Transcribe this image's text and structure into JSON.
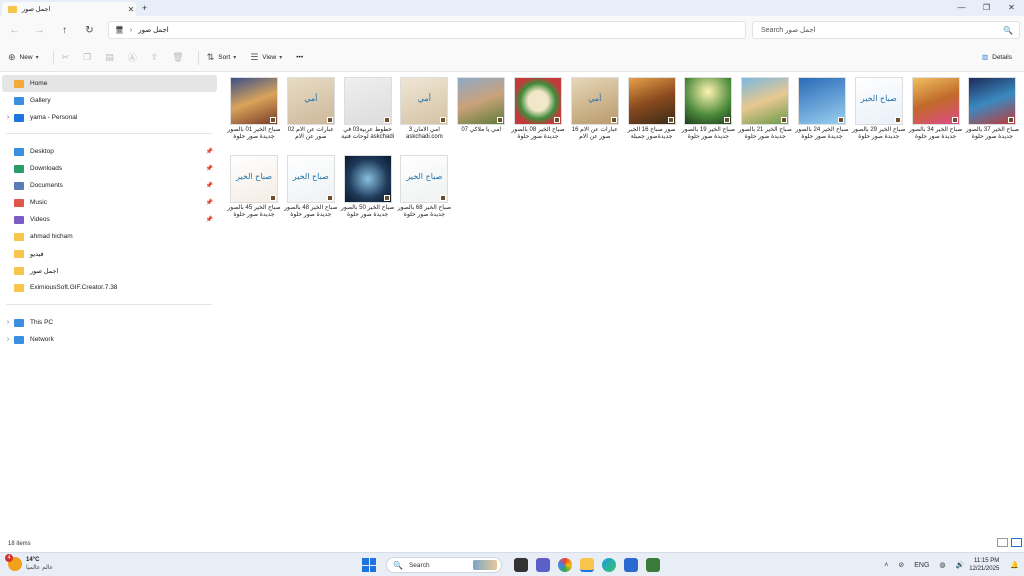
{
  "window": {
    "tab_title": "اجمل صور",
    "tab_close": "✕",
    "new_tab": "+",
    "controls": [
      "—",
      "❐",
      "✕"
    ]
  },
  "nav": {
    "back": "←",
    "forward": "→",
    "up": "↑",
    "refresh": "↻"
  },
  "address": {
    "path": "اجمل صور",
    "chevron": "›",
    "pc_icon": "🖥"
  },
  "search": {
    "placeholder": "Search اجمل صور",
    "icon": "🔍"
  },
  "toolbar": {
    "new_label": "New",
    "sort_label": "Sort",
    "view_label": "View",
    "more_label": "•••",
    "details_label": "Details"
  },
  "sidebar": {
    "items": [
      {
        "label": "Home",
        "icon": "home-icon",
        "color": "#f4a93b",
        "expand": "",
        "selected": true
      },
      {
        "label": "Gallery",
        "icon": "gallery-icon",
        "color": "#3b8fe0",
        "expand": ""
      },
      {
        "label": "yama - Personal",
        "icon": "cloud-icon",
        "color": "#1d73e0",
        "expand": "›"
      },
      {
        "label": "Desktop",
        "icon": "desktop-icon",
        "color": "#3b8fe0",
        "pinned": true
      },
      {
        "label": "Downloads",
        "icon": "download-icon",
        "color": "#2a9d6b",
        "pinned": true
      },
      {
        "label": "Documents",
        "icon": "documents-icon",
        "color": "#5a7bb5",
        "pinned": true
      },
      {
        "label": "Music",
        "icon": "music-icon",
        "color": "#e0564b",
        "pinned": true
      },
      {
        "label": "Videos",
        "icon": "videos-icon",
        "color": "#7b5cc6",
        "pinned": true
      },
      {
        "label": "ahmad hicham",
        "icon": "folder-icon",
        "color": "#f7c44c"
      },
      {
        "label": "فيديو",
        "icon": "folder-icon",
        "color": "#f7c44c"
      },
      {
        "label": "اجمل صور",
        "icon": "folder-icon",
        "color": "#f7c44c"
      },
      {
        "label": "EximiousSoft.GIF.Creator.7.38",
        "icon": "folder-icon",
        "color": "#f7c44c"
      },
      {
        "label": "This PC",
        "icon": "pc-icon",
        "color": "#3b8fe0",
        "expand": "›"
      },
      {
        "label": "Network",
        "icon": "network-icon",
        "color": "#3b8fe0",
        "expand": "›"
      }
    ]
  },
  "files": [
    {
      "name": "صباح الخير 01 بالصور جديدة صور حلوة",
      "bg": "linear-gradient(160deg,#3a4f8a,#d9a45a,#7a3b2a)",
      "thumb_text": ""
    },
    {
      "name": "عبارات عن الام 02 صور عن الام",
      "bg": "linear-gradient(160deg,#e8dcc5,#cdb89a)",
      "thumb_text": "أمي"
    },
    {
      "name": "خطوط عربية03 في لوحات فنية askchadi",
      "bg": "linear-gradient(160deg,#efefef,#dcdcdc)",
      "thumb_text": ""
    },
    {
      "name": "امي الامان 3 askchadi.com",
      "bg": "linear-gradient(160deg,#efe6d5,#d4c3a4)",
      "thumb_text": "أمي"
    },
    {
      "name": "امي يا ملاكي 07",
      "bg": "linear-gradient(160deg,#8fa9c9,#c9a27a,#5e7b3b)",
      "thumb_text": ""
    },
    {
      "name": "صباح الخير 08 بالصور جديدة صور حلوة",
      "bg": "radial-gradient(circle,#f2e8c9 30%,#3f8a3a 55%,#c23a3a 75%)",
      "thumb_text": ""
    },
    {
      "name": "عبارات عن الام 16 صور عن الام",
      "bg": "linear-gradient(160deg,#e6d6b8,#b99a6a)",
      "thumb_text": "أمي"
    },
    {
      "name": "صور صباح 16 الخير جديدةصور جميلة",
      "bg": "linear-gradient(160deg,#e7a04a,#8a4a1e,#3a2a18)",
      "thumb_text": ""
    },
    {
      "name": "صباح الخير 19 بالصور جديدة صور حلوة",
      "bg": "radial-gradient(circle at 50% 30%,#fff3b0,#4a8a3a 60%,#1e3a1e)",
      "thumb_text": ""
    },
    {
      "name": "صباح الخير 21 بالصور جديدة صور حلوة",
      "bg": "linear-gradient(160deg,#7ab8e0,#e8c890,#6a9a4a)",
      "thumb_text": ""
    },
    {
      "name": "صباح الخير 24 بالصور جديدة صور حلوة",
      "bg": "linear-gradient(160deg,#2a6ab8,#9ad0f0)",
      "thumb_text": ""
    },
    {
      "name": "صباح الخير 29 بالصور جديدة صور حلوة",
      "bg": "linear-gradient(160deg,#ffffff,#e8f0f8)",
      "thumb_text": "صباح الخير"
    },
    {
      "name": "صباح الخير 34 بالصور جديدة صور حلوة",
      "bg": "linear-gradient(160deg,#f0c060,#c06a2a,#e04a8a)",
      "thumb_text": ""
    },
    {
      "name": "صباح الخير 37 بالصور جديدة صور حلوة",
      "bg": "linear-gradient(160deg,#1e2a5a,#3a8ac0,#c03a3a)",
      "thumb_text": ""
    },
    {
      "name": "صباح الخير 45 بالصور جديدة صور حلوة",
      "bg": "linear-gradient(160deg,#ffffff,#f4ece4)",
      "thumb_text": "صباح الخير"
    },
    {
      "name": "صباح الخير 48 بالصور جديدة صور حلوة",
      "bg": "linear-gradient(160deg,#ffffff,#eef2f4)",
      "thumb_text": "صباح الخير"
    },
    {
      "name": "صباح الخير 50 بالصور جديدة صور حلوة",
      "bg": "radial-gradient(circle,#8ac0e0,#1e3a5a 60%,#0a1a2a)",
      "thumb_text": ""
    },
    {
      "name": "صباح الخير 68 بالصور جديدة صور حلوة",
      "bg": "linear-gradient(160deg,#ffffff,#eef2f0)",
      "thumb_text": "صباح الخير"
    }
  ],
  "status": {
    "item_count": "18 items"
  },
  "taskbar": {
    "weather_temp": "14°C",
    "weather_location": "عالم عالميا",
    "weather_badge": "4",
    "search_label": "Search",
    "language": "ENG",
    "time": "11:15 PM",
    "date": "12/21/2025"
  }
}
